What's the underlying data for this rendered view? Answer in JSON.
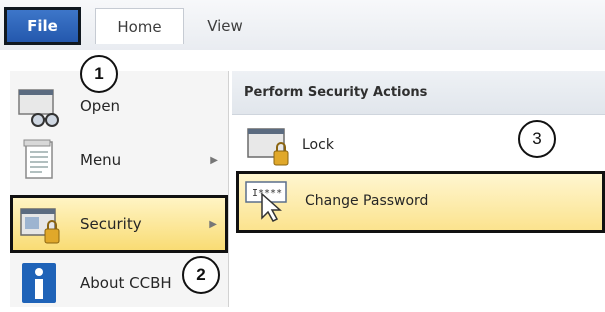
{
  "ribbon": {
    "file_tab": "File",
    "tabs": [
      {
        "label": "Home"
      },
      {
        "label": "View"
      }
    ]
  },
  "left_menu": {
    "items": [
      {
        "label": "Open",
        "icon": "folder-glasses-icon"
      },
      {
        "label": "Menu",
        "icon": "document-icon",
        "has_submenu": true
      },
      {
        "label": "Security",
        "icon": "window-lock-icon",
        "has_submenu": true,
        "selected": true
      },
      {
        "label": "About CCBH",
        "icon": "info-icon"
      }
    ]
  },
  "right_panel": {
    "header": "Perform Security Actions",
    "actions": [
      {
        "label": "Lock",
        "icon": "window-lock-icon"
      },
      {
        "label": "Change Password",
        "icon": "password-cursor-icon",
        "highlighted": true
      }
    ]
  },
  "callouts": [
    "1",
    "2",
    "3"
  ],
  "colors": {
    "file_tab": "#2458ad",
    "highlight": "#f9dc74",
    "outline": "#111111"
  }
}
